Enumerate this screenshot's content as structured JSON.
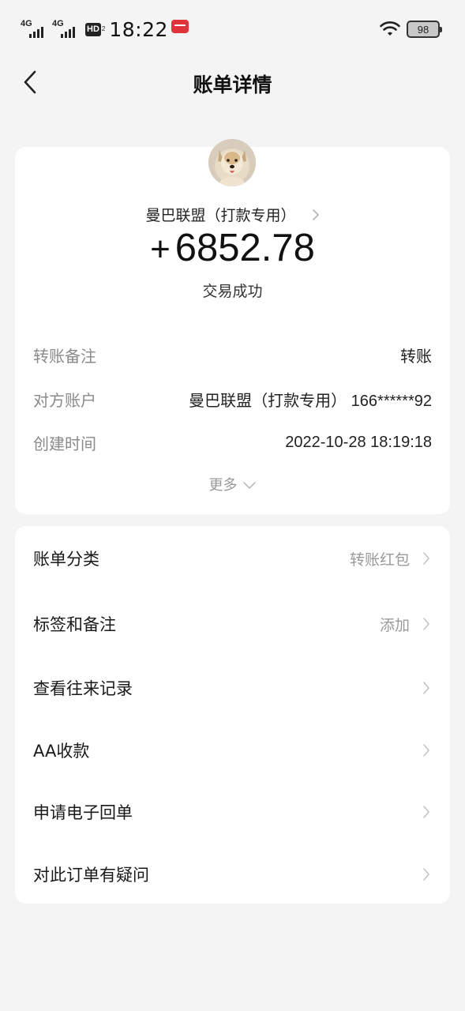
{
  "status_bar": {
    "signal1": "4G",
    "signal2": "4G",
    "hd": "HD",
    "hd_sub": "2",
    "time": "18:22",
    "battery": "98"
  },
  "header": {
    "title": "账单详情",
    "back_icon": "chevron-left-icon"
  },
  "transaction": {
    "payee": "曼巴联盟（打款专用）",
    "sign": "+",
    "amount": "6852.78",
    "status": "交易成功",
    "details": [
      {
        "label": "转账备注",
        "value": "转账"
      },
      {
        "label": "对方账户",
        "value": "曼巴联盟（打款专用） 166******92"
      },
      {
        "label": "创建时间",
        "value": "2022-10-28 18:19:18"
      }
    ],
    "more_label": "更多"
  },
  "actions": [
    {
      "label": "账单分类",
      "value": "转账红包"
    },
    {
      "label": "标签和备注",
      "value": "添加"
    },
    {
      "label": "查看往来记录",
      "value": ""
    },
    {
      "label": "AA收款",
      "value": ""
    },
    {
      "label": "申请电子回单",
      "value": ""
    },
    {
      "label": "对此订单有疑问",
      "value": ""
    }
  ],
  "colors": {
    "background": "#f4f4f4",
    "card": "#ffffff",
    "muted_text": "#8a8a8a",
    "primary_text": "#111111"
  }
}
